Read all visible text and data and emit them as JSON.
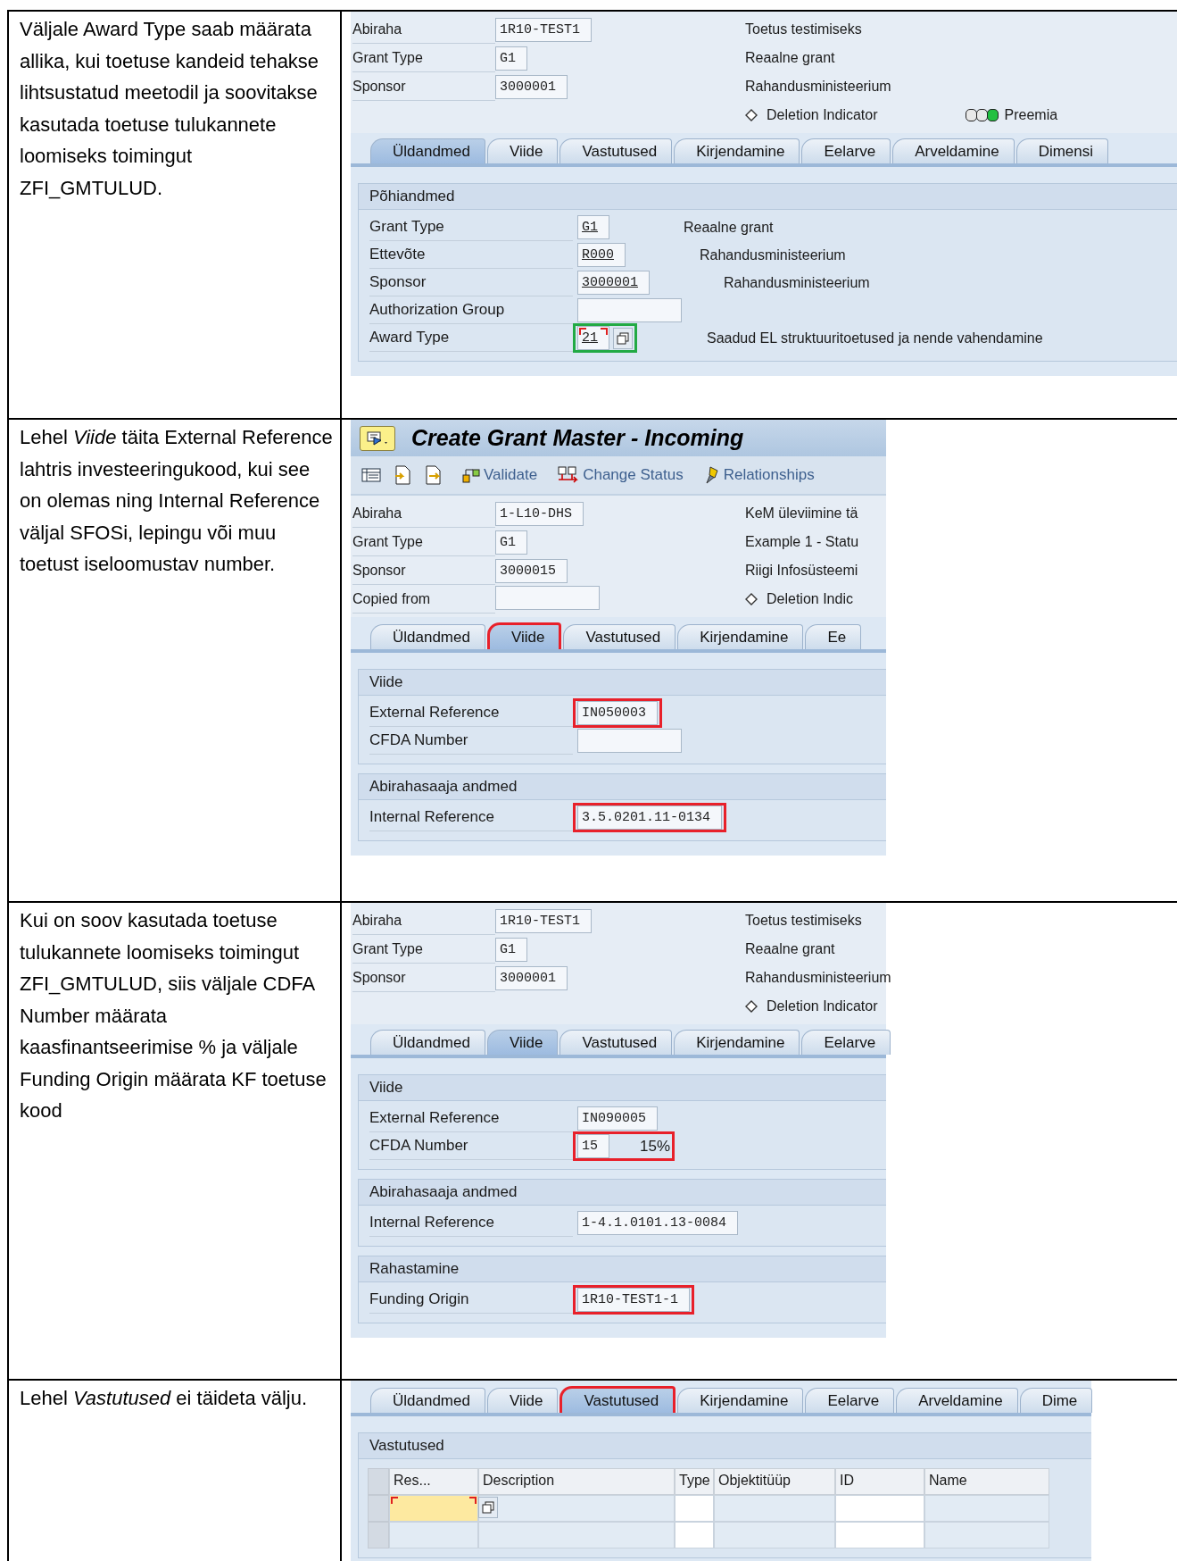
{
  "rows": [
    {
      "instruction": "Väljale Award Type saab määrata allika, kui toetuse kandeid tehakse lihtsustatud meetodil ja soovitakse kasutada toetuse tulukannete loomiseks toimingut ZFI_GMTULUD.",
      "screen": {
        "header": [
          {
            "label": "Abiraha",
            "value": "1R10-TEST1",
            "description": "Toetus testimiseks"
          },
          {
            "label": "Grant Type",
            "value": "G1",
            "description": "Reaalne grant"
          },
          {
            "label": "Sponsor",
            "value": "3000001",
            "description": "Rahandusministeerium"
          },
          {
            "deletion": "Deletion Indicator",
            "status": {
              "label": "Preemia",
              "lights": [
                {
                  "on": false
                },
                {
                  "on": false
                },
                {
                  "on": true
                }
              ]
            }
          }
        ],
        "tabs": [
          {
            "label": "Üldandmed",
            "selected": true
          },
          {
            "label": "Viide",
            "selected": false
          },
          {
            "label": "Vastutused",
            "selected": false
          },
          {
            "label": "Kirjendamine",
            "selected": false
          },
          {
            "label": "Eelarve",
            "selected": false
          },
          {
            "label": "Arveldamine",
            "selected": false
          },
          {
            "label": "Dimensi",
            "selected": false
          }
        ],
        "groups": [
          {
            "title": "Põhiandmed",
            "fields": [
              {
                "label": "Grant Type",
                "value": "G1",
                "description": "Reaalne grant",
                "required": false
              },
              {
                "label": "Ettevõte",
                "value": "R000",
                "description": "Rahandusministeerium",
                "required": false
              },
              {
                "label": "Sponsor",
                "value": "3000001",
                "description": "Rahandusministeerium",
                "required": false
              },
              {
                "label": "Authorization Group",
                "required": false
              },
              {
                "label": "Award Type",
                "value": "21",
                "description": "Saadud EL struktuuritoetused ja nende vahendamine",
                "required": true,
                "value_help": true,
                "color": "#22aa44"
              }
            ]
          }
        ]
      }
    },
    {
      "instruction": "Lehel *Viide* täita External Reference lahtris investeeringukood, kui see on olemas ning Internal Reference väljal SFOSi, lepingu või muu toetust iseloomustav number.",
      "screen": {
        "title": "Create Grant Master - Incoming",
        "toolbar": [
          "Validate",
          "Change Status",
          "Relationships"
        ],
        "header": [
          {
            "label": "Abiraha",
            "value": "1-L10-DHS",
            "description": "KeM üleviimine tä"
          },
          {
            "label": "Grant Type",
            "value": "G1",
            "description": "Example 1 - Statu"
          },
          {
            "label": "Sponsor",
            "value": "3000015",
            "description": "Riigi Infosüsteemi"
          },
          {
            "label": "Copied from",
            "deletion": "Deletion Indic"
          }
        ],
        "tabs": [
          {
            "label": "Üldandmed",
            "selected": false
          },
          {
            "label": "Viide",
            "selected": true,
            "color": "#e8202a"
          },
          {
            "label": "Vastutused",
            "selected": false
          },
          {
            "label": "Kirjendamine",
            "selected": false
          },
          {
            "label": "Ee",
            "selected": false
          }
        ],
        "groups": [
          {
            "title": "Viide",
            "fields": [
              {
                "label": "External Reference",
                "value": "IN050003",
                "required": false,
                "color": "#e8202a"
              },
              {
                "label": "CFDA Number",
                "required": false
              }
            ]
          },
          {
            "title": "Abirahasaaja andmed",
            "fields": [
              {
                "label": "Internal Reference",
                "value": "3.5.0201.11-0134",
                "required": false,
                "color": "#e8202a"
              }
            ]
          }
        ]
      }
    },
    {
      "instruction": "Kui on soov kasutada toetuse tulukannete loomiseks toimingut ZFI_GMTULUD, siis väljale CDFA Number määrata kaasfinantseerimise % ja väljale Funding Origin määrata KF toetuse kood",
      "screen": {
        "header": [
          {
            "label": "Abiraha",
            "value": "1R10-TEST1",
            "description": "Toetus testimiseks"
          },
          {
            "label": "Grant Type",
            "value": "G1",
            "description": "Reaalne grant"
          },
          {
            "label": "Sponsor",
            "value": "3000001",
            "description": "Rahandusministeerium"
          },
          {
            "deletion": "Deletion Indicator"
          }
        ],
        "tabs": [
          {
            "label": "Üldandmed",
            "selected": false
          },
          {
            "label": "Viide",
            "selected": true
          },
          {
            "label": "Vastutused",
            "selected": false
          },
          {
            "label": "Kirjendamine",
            "selected": false
          },
          {
            "label": "Eelarve",
            "selected": false
          }
        ],
        "groups": [
          {
            "title": "Viide",
            "fields": [
              {
                "label": "External Reference",
                "value": "IN090005",
                "required": false
              },
              {
                "label": "CFDA Number",
                "value": "15",
                "suffix": "15%",
                "required": false,
                "color": "#e8202a"
              }
            ]
          },
          {
            "title": "Abirahasaaja andmed",
            "fields": [
              {
                "label": "Internal Reference",
                "value": "1-4.1.0101.13-0084",
                "required": false
              }
            ]
          },
          {
            "title": "Rahastamine",
            "fields": [
              {
                "label": "Funding Origin",
                "value": "1R10-TEST1-1",
                "required": false,
                "color": "#e8202a"
              }
            ]
          }
        ]
      }
    },
    {
      "instruction": "Lehel *Vastutused* ei täideta välju.",
      "screen": {
        "tabs": [
          {
            "label": "Üldandmed",
            "selected": false
          },
          {
            "label": "Viide",
            "selected": false
          },
          {
            "label": "Vastutused",
            "selected": true,
            "color": "#e8202a"
          },
          {
            "label": "Kirjendamine",
            "selected": false
          },
          {
            "label": "Eelarve",
            "selected": false
          },
          {
            "label": "Arveldamine",
            "selected": false
          },
          {
            "label": "Dime",
            "selected": false
          }
        ],
        "groups": [
          {
            "title": "Vastutused",
            "table": {
              "columns": [
                "Res...",
                "Description",
                "Type",
                "Objektitüüp",
                "ID",
                "Name"
              ],
              "rows": [
                {
                  "required": true,
                  "value_help": true
                },
                {
                  "required": false
                }
              ]
            }
          }
        ]
      }
    }
  ]
}
